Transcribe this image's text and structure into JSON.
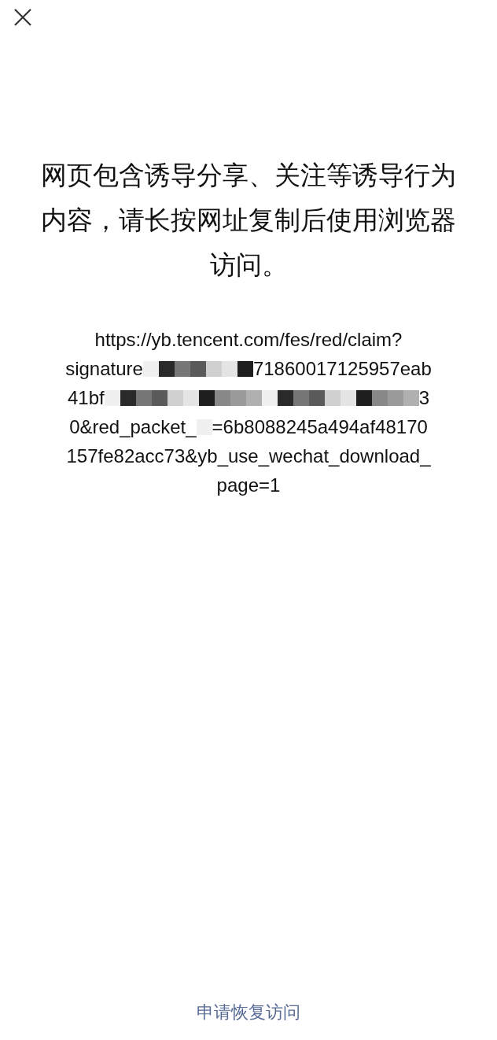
{
  "notice": "网页包含诱导分享、关注等诱导行为内容，请长按网址复制后使用浏览器访问。",
  "url_lines": [
    {
      "segments": [
        {
          "kind": "text",
          "text": "https://yb.tencent.com/fes/red/claim?"
        }
      ]
    },
    {
      "segments": [
        {
          "kind": "text",
          "text": "signature"
        },
        {
          "kind": "mosaic_medium"
        },
        {
          "kind": "text",
          "text": "71860017125957eab"
        }
      ]
    },
    {
      "segments": [
        {
          "kind": "text",
          "text": "41bf"
        },
        {
          "kind": "mosaic_long"
        },
        {
          "kind": "text",
          "text": "3"
        }
      ]
    },
    {
      "segments": [
        {
          "kind": "text",
          "text": "0&red_packet_"
        },
        {
          "kind": "mosaic_short"
        },
        {
          "kind": "text",
          "text": "=6b8088245a494af48170"
        }
      ]
    },
    {
      "segments": [
        {
          "kind": "text",
          "text": "157fe82acc73&yb_use_wechat_download_"
        }
      ]
    },
    {
      "segments": [
        {
          "kind": "text",
          "text": "page=1"
        }
      ]
    }
  ],
  "footer_link": "申请恢复访问"
}
